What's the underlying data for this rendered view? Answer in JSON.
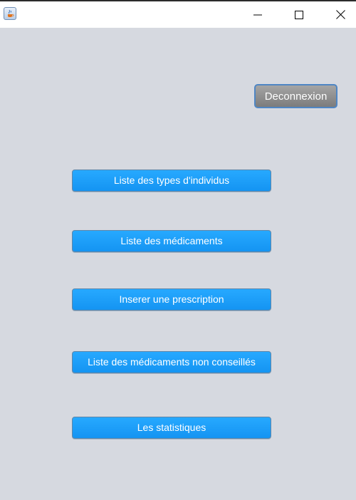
{
  "window": {
    "controls": {
      "minimize_icon": "minimize-icon",
      "maximize_icon": "maximize-icon",
      "close_icon": "close-icon"
    },
    "app_icon": "java-icon"
  },
  "main": {
    "logout_label": "Deconnexion",
    "menu": [
      {
        "label": "Liste des types d'individus"
      },
      {
        "label": "Liste des médicaments"
      },
      {
        "label": "Inserer une prescription"
      },
      {
        "label": "Liste des médicaments non conseillés"
      },
      {
        "label": "Les statistiques"
      }
    ]
  },
  "colors": {
    "background": "#d6d9e0",
    "button_blue": "#1b9cf7",
    "button_gray": "#8f8f8f",
    "focus_border": "#4f86c4"
  }
}
